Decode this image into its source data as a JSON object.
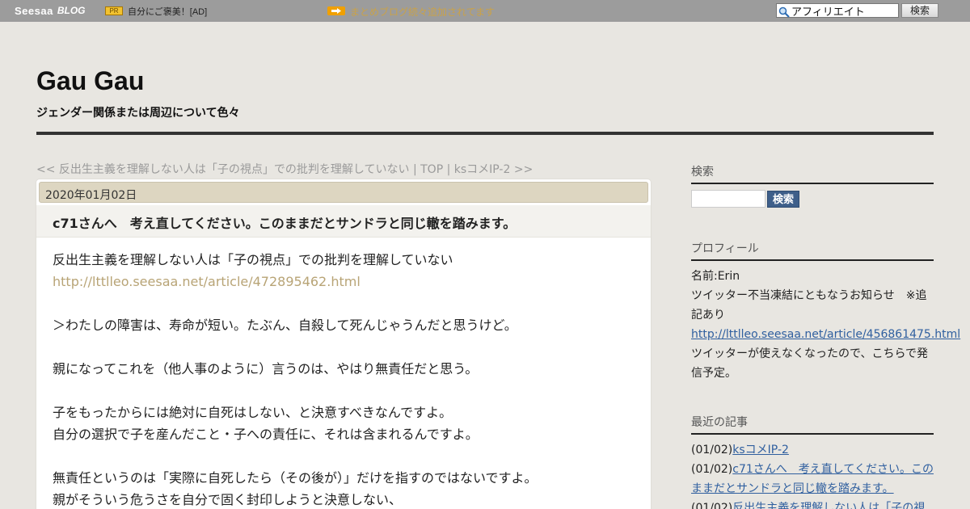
{
  "topbar": {
    "logo_main": "Seesaa",
    "logo_blog": "BLOG",
    "pr_label": "PR",
    "ad_text": "自分にご褒美！[AD]",
    "promo_text": "まとめブログ続々追加されてます",
    "search_value": "アフィリエイト",
    "search_button": "検索"
  },
  "header": {
    "title": "Gau Gau",
    "description": "ジェンダー関係または周辺について色々"
  },
  "nav": {
    "prev": "<< 反出生主義を理解しない人は「子の視点」での批判を理解していない",
    "sep1": " | ",
    "top": "TOP",
    "sep2": " | ",
    "next": "ksコメIP-2 >>"
  },
  "article": {
    "date": "2020年01月02日",
    "title": "c71さんへ　考え直してください。このままだとサンドラと同じ轍を踏みます。",
    "lines": [
      "反出生主義を理解しない人は「子の視点」での批判を理解していない",
      "http://lttlleo.seesaa.net/article/472895462.html",
      "",
      "＞わたしの障害は、寿命が短い。たぶん、自殺して死んじゃうんだと思うけど。",
      "",
      "親になってこれを（他人事のように）言うのは、やはり無責任だと思う。",
      "",
      "子をもったからには絶対に自死はしない、と決意すべきなんですよ。",
      "自分の選択で子を産んだこと・子への責任に、それは含まれるんですよ。",
      "",
      "無責任というのは「実際に自死したら（その後が）」だけを指すのではないですよ。",
      "親がそういう危うさを自分で固く封印しようと決意しない、"
    ]
  },
  "sidebar": {
    "search_heading": "検索",
    "search_button": "検索",
    "profile_heading": "プロフィール",
    "profile_name": "名前:Erin",
    "profile_notice": "ツイッター不当凍結にともなうお知らせ　※追記あり",
    "profile_link": "http://lttlleo.seesaa.net/article/456861475.html",
    "profile_note": "ツイッターが使えなくなったので、こちらで発信予定。",
    "recent_heading": "最近の記事",
    "recent": [
      {
        "date": "(01/02)",
        "title": "ksコメIP-2"
      },
      {
        "date": "(01/02)",
        "title": "c71さんへ　考え直してください。このままだとサンドラと同じ轍を踏みます。"
      },
      {
        "date": "(01/02)",
        "title": "反出生主義を理解しない人は「子の視"
      }
    ]
  }
}
